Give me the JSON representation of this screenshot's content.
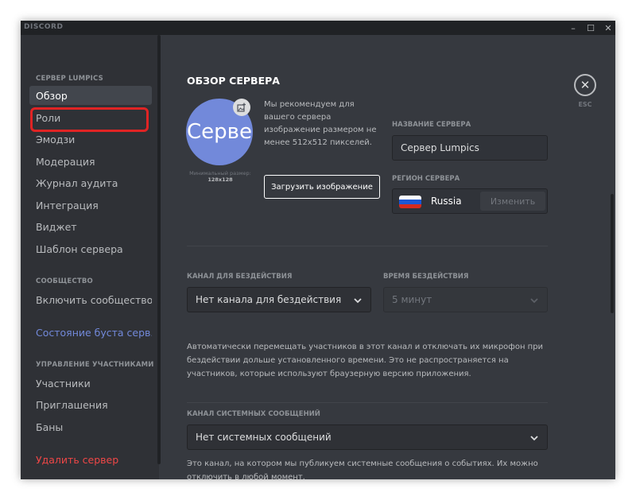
{
  "titlebar": {
    "brand": "DISCORD",
    "minimize": "–",
    "maximize": "☐",
    "close": "✕"
  },
  "sidebar": {
    "header_server": "СЕРВЕР LUMPICS",
    "items_server": [
      "Обзор",
      "Роли",
      "Эмодзи",
      "Модерация",
      "Журнал аудита",
      "Интеграция",
      "Виджет",
      "Шаблон сервера"
    ],
    "header_community": "СООБЩЕСТВО",
    "enable_community": "Включить сообщество",
    "boost_status": "Состояние буста серв...",
    "header_members": "УПРАВЛЕНИЕ УЧАСТНИКАМИ",
    "items_members": [
      "Участники",
      "Приглашения",
      "Баны"
    ],
    "delete_server": "Удалить сервер"
  },
  "overview": {
    "title": "ОБЗОР СЕРВЕРА",
    "esc": "ESC",
    "avatar_text": "Серве",
    "min_size_label": "Минимальный размер:",
    "min_size_value": "128x128",
    "recommendation": "Мы рекомендуем для вашего сервера изображение размером не менее 512x512 пикселей.",
    "upload_button": "Загрузить изображение",
    "server_name_label": "НАЗВАНИЕ СЕРВЕРА",
    "server_name_value": "Сервер Lumpics",
    "region_label": "РЕГИОН СЕРВЕРА",
    "region_value": "Russia",
    "change_button": "Изменить"
  },
  "afk": {
    "channel_label": "КАНАЛ ДЛЯ БЕЗДЕЙСТВИЯ",
    "channel_value": "Нет канала для бездействия",
    "timeout_label": "ВРЕМЯ БЕЗДЕЙСТВИЯ",
    "timeout_value": "5 минут",
    "help": "Автоматически перемещать участников в этот канал и отключать их микрофон при бездействии дольше установленного времени. Это не распространяется на участников, которые используют браузерную версию приложения."
  },
  "system": {
    "channel_label": "КАНАЛ СИСТЕМНЫХ СООБЩЕНИЙ",
    "channel_value": "Нет системных сообщений",
    "help": "Это канал, на котором мы публикуем системные сообщения о событиях. Их можно отключить в любой момент."
  },
  "colors": {
    "accent": "#7289da",
    "danger": "#f04747",
    "highlight": "#e02424"
  }
}
